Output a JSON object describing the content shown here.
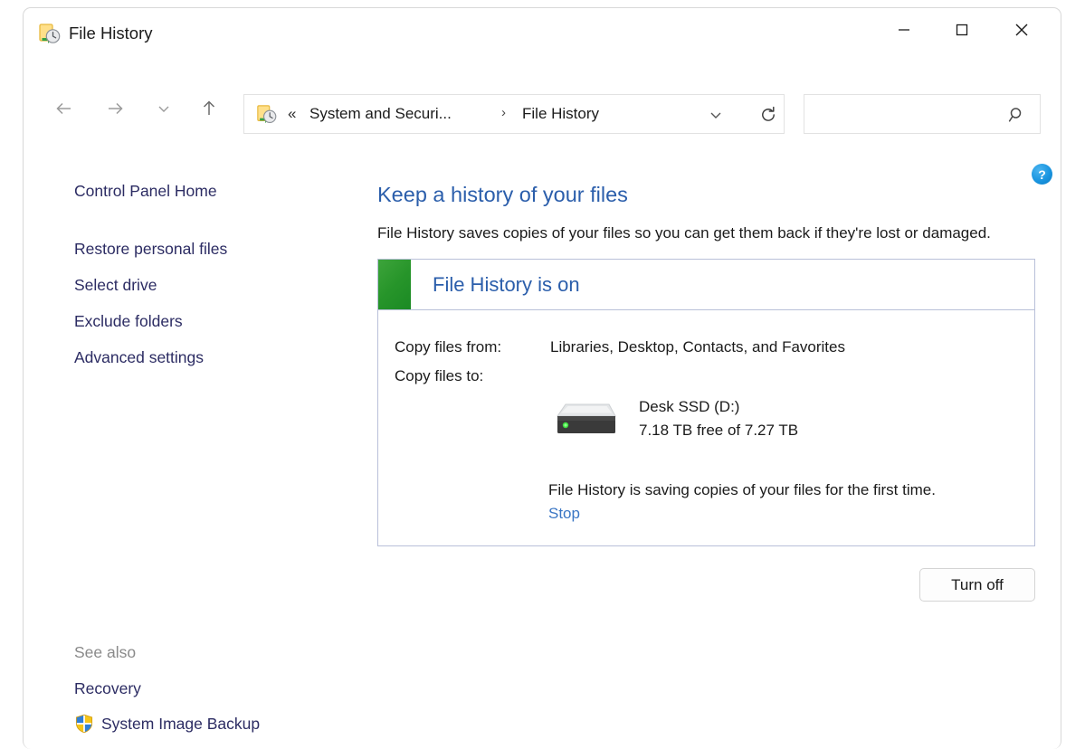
{
  "window": {
    "title": "File History",
    "title_icon": "file-history-icon",
    "controls": {
      "minimize": "minimize-icon",
      "maximize": "maximize-icon",
      "close": "close-icon"
    }
  },
  "toolbar": {
    "back": "back-arrow-icon",
    "forward": "forward-arrow-icon",
    "recent": "chevron-down-icon",
    "up": "up-arrow-icon",
    "address": {
      "icon": "file-history-icon",
      "chevrons": "«",
      "crumb1": "System and Securi...",
      "separator": "›",
      "crumb2": "File History",
      "dropdown": "chevron-down-icon",
      "refresh": "refresh-icon"
    },
    "search": {
      "value": "",
      "placeholder": "",
      "icon": "search-icon"
    }
  },
  "help": {
    "label": "?",
    "name": "help-button"
  },
  "sidebar": {
    "home": "Control Panel Home",
    "items": [
      {
        "label": "Restore personal files"
      },
      {
        "label": "Select drive"
      },
      {
        "label": "Exclude folders"
      },
      {
        "label": "Advanced settings"
      }
    ],
    "see_also": {
      "label": "See also",
      "recovery": "Recovery",
      "system_image_backup": "System Image Backup",
      "shield_icon": "shield-icon"
    }
  },
  "main": {
    "heading": "Keep a history of your files",
    "description": "File History saves copies of your files so you can get them back if they're lost or damaged.",
    "status": {
      "title": "File History is on",
      "swatch_color": "#27952a",
      "copy_from_label": "Copy files from:",
      "copy_from_value": "Libraries, Desktop, Contacts, and Favorites",
      "copy_to_label": "Copy files to:",
      "drive_icon": "external-drive-icon",
      "drive_name": "Desk SSD (D:)",
      "drive_space": "7.18 TB free of 7.27 TB",
      "saving_text": "File History is saving copies of your files for the first time.",
      "stop_link": "Stop"
    },
    "turn_off_button": "Turn off"
  },
  "colors": {
    "heading_blue": "#2b5eab",
    "link_navy": "#2c2c63",
    "link_blue": "#3a76c4",
    "status_green": "#27952a",
    "help_blue": "#1a95e0",
    "panel_border": "#b9c0d9"
  }
}
